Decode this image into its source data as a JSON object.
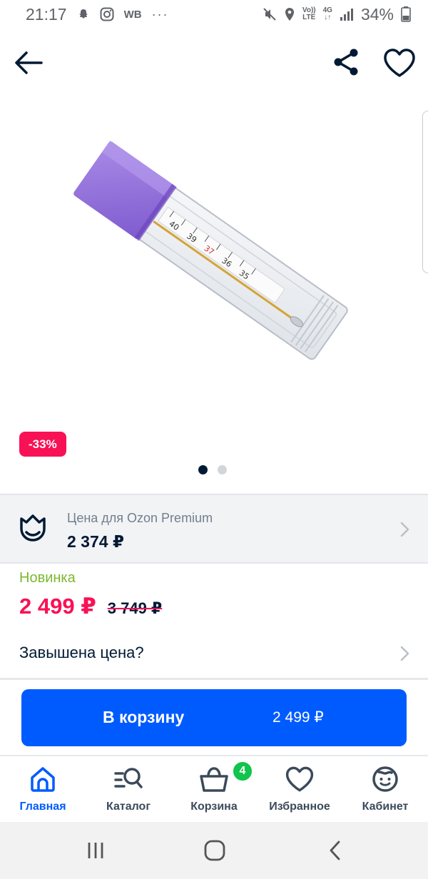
{
  "status_bar": {
    "time": "21:17",
    "wb_label": "WB",
    "more_dots": "···",
    "volte_top": "Vo))",
    "volte_bottom": "LTE",
    "net_top": "4G",
    "net_bottom": "↓↑",
    "battery": "34%",
    "icons": [
      "snapchat-icon",
      "instagram-icon",
      "mute-icon",
      "location-icon",
      "signal-icon",
      "battery-icon"
    ]
  },
  "top_bar": {
    "icons": [
      "back-arrow-icon",
      "share-icon",
      "heart-icon"
    ]
  },
  "product": {
    "image_subject": "clinical glass mercury thermometer in purple-capped clear plastic case",
    "discount": "-33%",
    "gallery_total": 2,
    "gallery_active": 1
  },
  "premium": {
    "label": "Цена для Ozon Premium",
    "price": "2 374 ₽",
    "icon": "ozon-premium-icon"
  },
  "pricing": {
    "badge": "Новинка",
    "current": "2 499 ₽",
    "old": "3 749 ₽",
    "overprice_label": "Завышена цена?"
  },
  "cart_button": {
    "label": "В корзину",
    "price": "2 499 ₽"
  },
  "bottom_nav": {
    "items": [
      {
        "label": "Главная",
        "icon": "home-icon",
        "active": true
      },
      {
        "label": "Каталог",
        "icon": "catalog-search-icon",
        "active": false
      },
      {
        "label": "Корзина",
        "icon": "basket-icon",
        "active": false
      },
      {
        "label": "Избранное",
        "icon": "heart-icon",
        "active": false
      },
      {
        "label": "Кабинет",
        "icon": "profile-face-icon",
        "active": false
      }
    ],
    "cart_count": "4"
  },
  "system_nav": {
    "icons": [
      "recent-apps-icon",
      "home-circle-icon",
      "back-chevron-icon"
    ]
  },
  "colors": {
    "primary": "#005bff",
    "sale": "#f91155",
    "new": "#7cb82f",
    "text": "#001a34",
    "muted": "#707f8d",
    "badge_green": "#10c44c"
  }
}
